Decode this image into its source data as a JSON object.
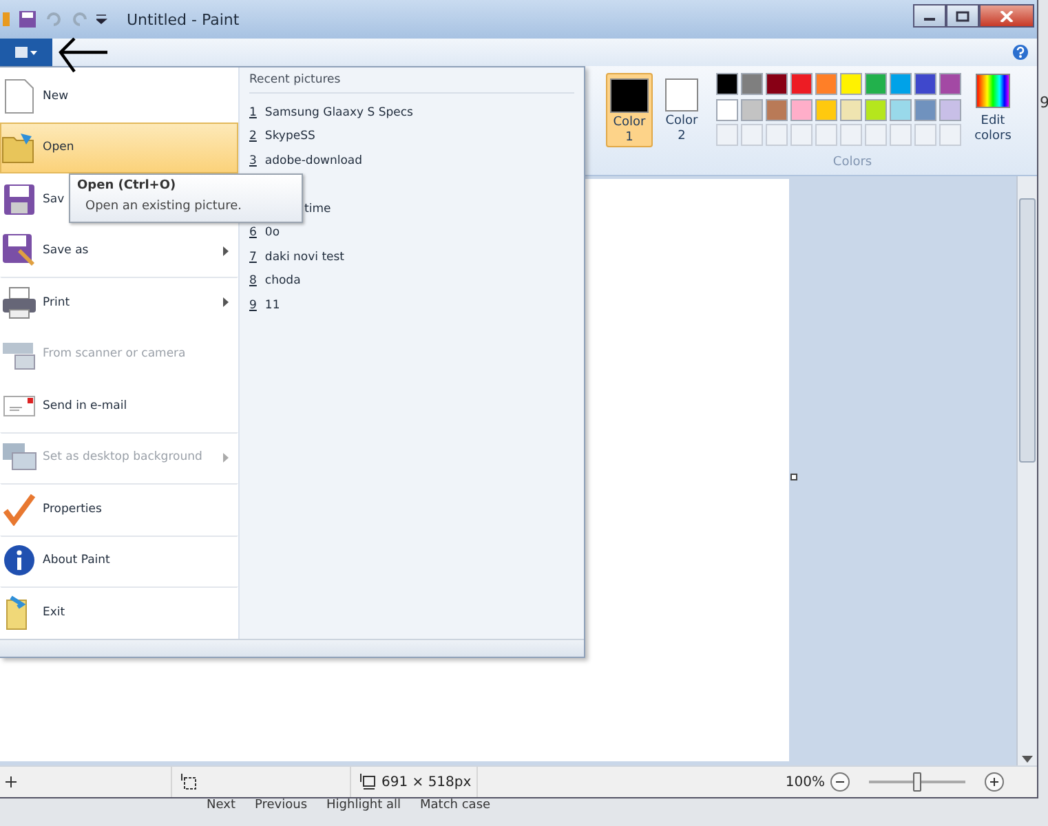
{
  "window": {
    "title": "Untitled - Paint"
  },
  "backdrop_text": "9",
  "ribbon": {
    "color_slots": [
      {
        "label": "Color 1",
        "color": "#000000",
        "selected": true
      },
      {
        "label": "Color 2",
        "color": "#ffffff",
        "selected": false
      }
    ],
    "palette": [
      {
        "kind": "swatch",
        "color": "#000000"
      },
      {
        "kind": "swatch",
        "color": "#7f7f7f"
      },
      {
        "kind": "swatch",
        "color": "#880015"
      },
      {
        "kind": "swatch",
        "color": "#ed1c24"
      },
      {
        "kind": "swatch",
        "color": "#ff7f27"
      },
      {
        "kind": "swatch",
        "color": "#fff200"
      },
      {
        "kind": "swatch",
        "color": "#22b14c"
      },
      {
        "kind": "swatch",
        "color": "#00a2e8"
      },
      {
        "kind": "swatch",
        "color": "#3f48cc"
      },
      {
        "kind": "swatch",
        "color": "#a349a4"
      },
      {
        "kind": "swatch",
        "color": "#ffffff"
      },
      {
        "kind": "swatch",
        "color": "#c3c3c3"
      },
      {
        "kind": "swatch",
        "color": "#b97a57"
      },
      {
        "kind": "swatch",
        "color": "#ffaec9"
      },
      {
        "kind": "swatch",
        "color": "#ffc90e"
      },
      {
        "kind": "swatch",
        "color": "#efe4b0"
      },
      {
        "kind": "swatch",
        "color": "#b5e61d"
      },
      {
        "kind": "swatch",
        "color": "#99d9ea"
      },
      {
        "kind": "swatch",
        "color": "#7092be"
      },
      {
        "kind": "swatch",
        "color": "#c8bfe7"
      },
      {
        "kind": "empty"
      },
      {
        "kind": "empty"
      },
      {
        "kind": "empty"
      },
      {
        "kind": "empty"
      },
      {
        "kind": "empty"
      },
      {
        "kind": "empty"
      },
      {
        "kind": "empty"
      },
      {
        "kind": "empty"
      },
      {
        "kind": "empty"
      },
      {
        "kind": "empty"
      }
    ],
    "edit_colors": "Edit colors",
    "group_label": "Colors"
  },
  "app_menu": {
    "items": [
      {
        "label": "New",
        "selected": false,
        "disabled": false,
        "submenu": false,
        "separator": false
      },
      {
        "label": "Open",
        "selected": true,
        "disabled": false,
        "submenu": false,
        "separator": false
      },
      {
        "label": "Sav",
        "selected": false,
        "disabled": false,
        "submenu": false,
        "separator": false
      },
      {
        "label": "Save as",
        "selected": false,
        "disabled": false,
        "submenu": true,
        "separator": false
      },
      {
        "label": "Print",
        "selected": false,
        "disabled": false,
        "submenu": true,
        "separator": true
      },
      {
        "label": "From scanner or camera",
        "selected": false,
        "disabled": true,
        "submenu": false,
        "separator": false
      },
      {
        "label": "Send in e-mail",
        "selected": false,
        "disabled": false,
        "submenu": false,
        "separator": false
      },
      {
        "label": "Set as desktop background",
        "selected": false,
        "disabled": true,
        "submenu": true,
        "separator": true
      },
      {
        "label": "Properties",
        "selected": false,
        "disabled": false,
        "submenu": false,
        "separator": true
      },
      {
        "label": "About Paint",
        "selected": false,
        "disabled": false,
        "submenu": false,
        "separator": true
      },
      {
        "label": "Exit",
        "selected": false,
        "disabled": false,
        "submenu": false,
        "separator": true
      }
    ],
    "recent": {
      "heading": "Recent pictures",
      "items": [
        {
          "kind": "full",
          "number": "1",
          "name": "Samsung Glaaxy S Specs"
        },
        {
          "kind": "full",
          "number": "2",
          "name": "SkypeSS"
        },
        {
          "kind": "full",
          "number": "3",
          "name": "adobe-download"
        },
        {
          "kind": "hidden"
        },
        {
          "kind": "partial",
          "name": "time"
        },
        {
          "kind": "full",
          "number": "6",
          "name": "0o"
        },
        {
          "kind": "full",
          "number": "7",
          "name": "daki novi test"
        },
        {
          "kind": "full",
          "number": "8",
          "name": "choda"
        },
        {
          "kind": "full",
          "number": "9",
          "name": "11"
        }
      ]
    }
  },
  "tooltip": {
    "title": "Open (Ctrl+O)",
    "text": "Open an existing picture."
  },
  "status_bar": {
    "canvas_size": "691 × 518px",
    "zoom": "100%",
    "zoom_slider": {
      "level": 0.5
    }
  },
  "find_bar": [
    "Next",
    "Previous",
    "Highlight all",
    "Match case"
  ]
}
